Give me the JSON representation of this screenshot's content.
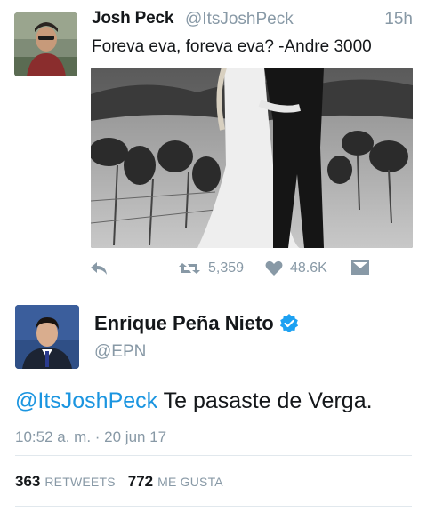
{
  "tweet1": {
    "name": "Josh Peck",
    "handle": "@ItsJoshPeck",
    "time": "15h",
    "text": "Foreva eva, foreva eva? -Andre 3000",
    "retweets": "5,359",
    "likes": "48.6K",
    "icons": [
      "reply-icon",
      "retweet-icon",
      "heart-icon",
      "message-icon"
    ]
  },
  "tweet2": {
    "name": "Enrique Peña Nieto",
    "handle": "@EPN",
    "mention": "@ItsJoshPeck",
    "text": " Te pasaste de Verga.",
    "timestamp": "10:52 a. m. · 20 jun 17",
    "retweets_count": "363",
    "retweets_label": "RETWEETS",
    "likes_count": "772",
    "likes_label": "ME GUSTA"
  },
  "colors": {
    "link": "#1b95e0",
    "verified": "#1da1f2",
    "muted": "#8899a6",
    "divider": "#e1e8ed"
  }
}
